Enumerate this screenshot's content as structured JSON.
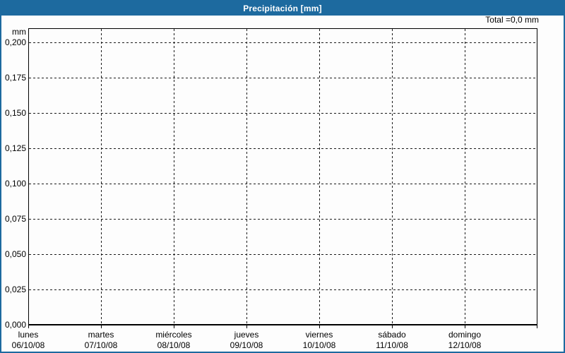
{
  "header": {
    "title": "Precipitación [mm]"
  },
  "annotations": {
    "total": "Total =0,0 mm"
  },
  "axes": {
    "y_unit": "mm"
  },
  "colors": {
    "accent": "#1d6a9f",
    "grid": "#1a1a1a",
    "axis": "#000000",
    "header_text": "#ffffff",
    "text": "#000000",
    "background": "#fdfdfd"
  },
  "chart_data": {
    "type": "bar",
    "title": "Precipitación [mm]",
    "ylabel": "mm",
    "xlabel": "",
    "categories": [
      "lunes",
      "martes",
      "miércoles",
      "jueves",
      "viernes",
      "sábado",
      "domingo"
    ],
    "category_dates": [
      "06/10/08",
      "07/10/08",
      "08/10/08",
      "09/10/08",
      "10/10/08",
      "11/10/08",
      "12/10/08"
    ],
    "values": [
      0,
      0,
      0,
      0,
      0,
      0,
      0
    ],
    "total_annotation": "Total =0,0 mm",
    "ylim": [
      0,
      0.21
    ],
    "yticks": [
      0.2,
      0.175,
      0.15,
      0.125,
      0.1,
      0.075,
      0.05,
      0.025,
      0.0
    ],
    "ytick_labels": [
      "0,200",
      "0,175",
      "0,150",
      "0,125",
      "0,100",
      "0,075",
      "0,050",
      "0,025",
      "0,000"
    ],
    "grid": true,
    "legend": false
  }
}
